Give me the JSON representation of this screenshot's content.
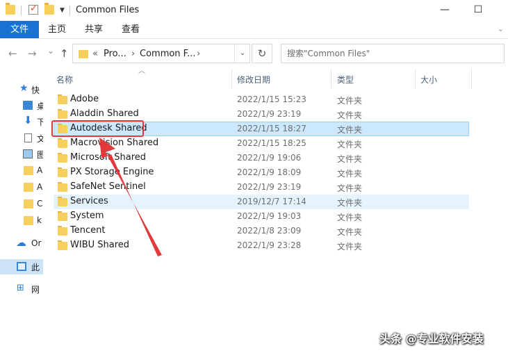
{
  "window": {
    "title": "Common Files",
    "minimize_glyph": "—",
    "maximize_glyph": "☐",
    "close_glyph": "✕"
  },
  "ribbon": {
    "tabs": [
      "文件",
      "主页",
      "共享",
      "查看"
    ],
    "expand_glyph": "⌄"
  },
  "nav": {
    "back_glyph": "←",
    "forward_glyph": "→",
    "recent_glyph": "⌄",
    "up_glyph": "↑",
    "breadcrumb": [
      "«",
      "Pro...",
      "Common F...",
      "›"
    ],
    "address_drop_glyph": "⌄",
    "refresh_glyph": "↻",
    "search_placeholder": "搜索\"Common Files\""
  },
  "navpane": {
    "items": [
      {
        "label": "快",
        "icon": "star-icon"
      },
      {
        "label": "桌",
        "icon": "desktop-icon"
      },
      {
        "label": "下",
        "icon": "download-icon"
      },
      {
        "label": "文",
        "icon": "document-icon"
      },
      {
        "label": "图",
        "icon": "pictures-icon"
      },
      {
        "label": "A",
        "icon": "folder-icon"
      },
      {
        "label": "A",
        "icon": "folder-icon"
      },
      {
        "label": "C",
        "icon": "folder-icon"
      },
      {
        "label": "k",
        "icon": "folder-icon"
      },
      {
        "label": "Or",
        "icon": "onedrive-icon"
      },
      {
        "label": "此",
        "icon": "this-pc-icon"
      },
      {
        "label": "网",
        "icon": "network-icon"
      }
    ]
  },
  "columns": {
    "name": "名称",
    "modified": "修改日期",
    "type": "类型",
    "size": "大小"
  },
  "files": [
    {
      "name": "Adobe",
      "date": "2022/1/15 15:23",
      "type": "文件夹"
    },
    {
      "name": "Aladdin Shared",
      "date": "2022/1/9 23:19",
      "type": "文件夹"
    },
    {
      "name": "Autodesk Shared",
      "date": "2022/1/15 18:27",
      "type": "文件夹"
    },
    {
      "name": "Macrovision Shared",
      "date": "2022/1/15 18:25",
      "type": "文件夹"
    },
    {
      "name": "Microsoft Shared",
      "date": "2022/1/9 19:06",
      "type": "文件夹"
    },
    {
      "name": "PX Storage Engine",
      "date": "2022/1/9 18:09",
      "type": "文件夹"
    },
    {
      "name": "SafeNet Sentinel",
      "date": "2022/1/9 23:19",
      "type": "文件夹"
    },
    {
      "name": "Services",
      "date": "2019/12/7 17:14",
      "type": "文件夹"
    },
    {
      "name": "System",
      "date": "2022/1/9 19:03",
      "type": "文件夹"
    },
    {
      "name": "Tencent",
      "date": "2022/1/8 23:09",
      "type": "文件夹"
    },
    {
      "name": "WIBU Shared",
      "date": "2022/1/9 23:28",
      "type": "文件夹"
    }
  ],
  "selected_file": "Autodesk Shared",
  "hovered_file": "Services",
  "annotation": {
    "color": "#e23a3a"
  },
  "watermark": "头条 @专业软件安装"
}
